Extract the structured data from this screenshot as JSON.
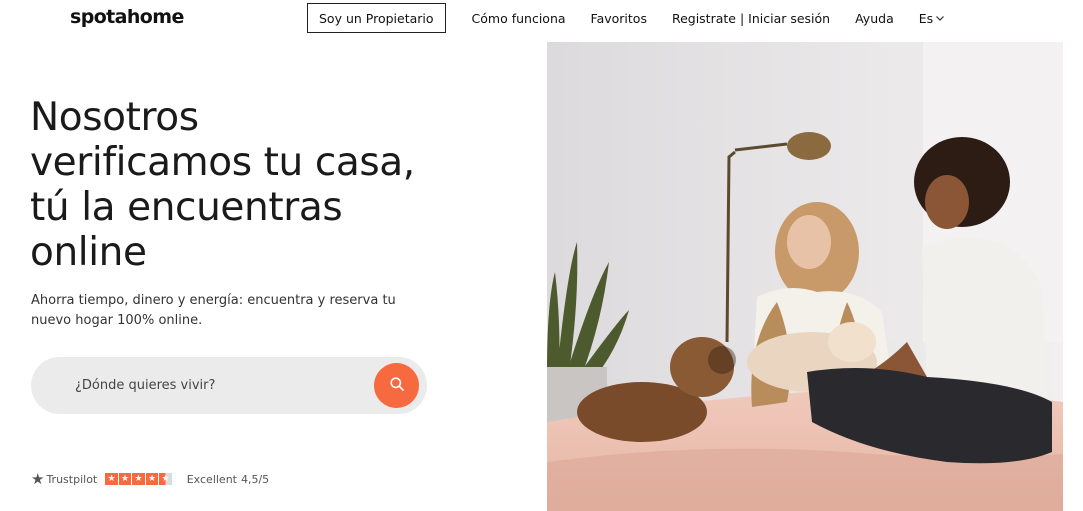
{
  "header": {
    "logo": "spotahome",
    "nav": {
      "owner": "Soy un Propietario",
      "how": "Cómo funciona",
      "favorites": "Favoritos",
      "auth": "Registrate | Iniciar sesión",
      "help": "Ayuda",
      "lang": "Es"
    }
  },
  "hero": {
    "title_lines": [
      "Nosotros",
      "verificamos tu casa,",
      "tú la encuentras",
      "online"
    ],
    "subtitle": "Ahorra tiempo, dinero y energía: encuentra y reserva tu nuevo hogar 100% online.",
    "search_placeholder": "¿Dónde quieres vivir?"
  },
  "rating": {
    "brand": "Trustpilot",
    "label": "Excellent",
    "score": "4,5/5",
    "stars": 4.5
  },
  "colors": {
    "accent": "#f7693f",
    "search_bg": "#ebebeb"
  },
  "icons": [
    "search-icon",
    "chevron-down-icon",
    "trustpilot-star-icon"
  ]
}
